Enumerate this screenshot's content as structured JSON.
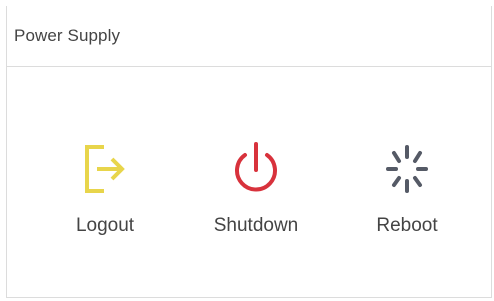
{
  "panel": {
    "title": "Power Supply"
  },
  "actions": [
    {
      "id": "logout",
      "label": "Logout",
      "icon": "logout-icon",
      "color": "#E8D54B"
    },
    {
      "id": "shutdown",
      "label": "Shutdown",
      "icon": "power-icon",
      "color": "#D8323C"
    },
    {
      "id": "reboot",
      "label": "Reboot",
      "icon": "reboot-spinner-icon",
      "color": "#555A66"
    }
  ]
}
